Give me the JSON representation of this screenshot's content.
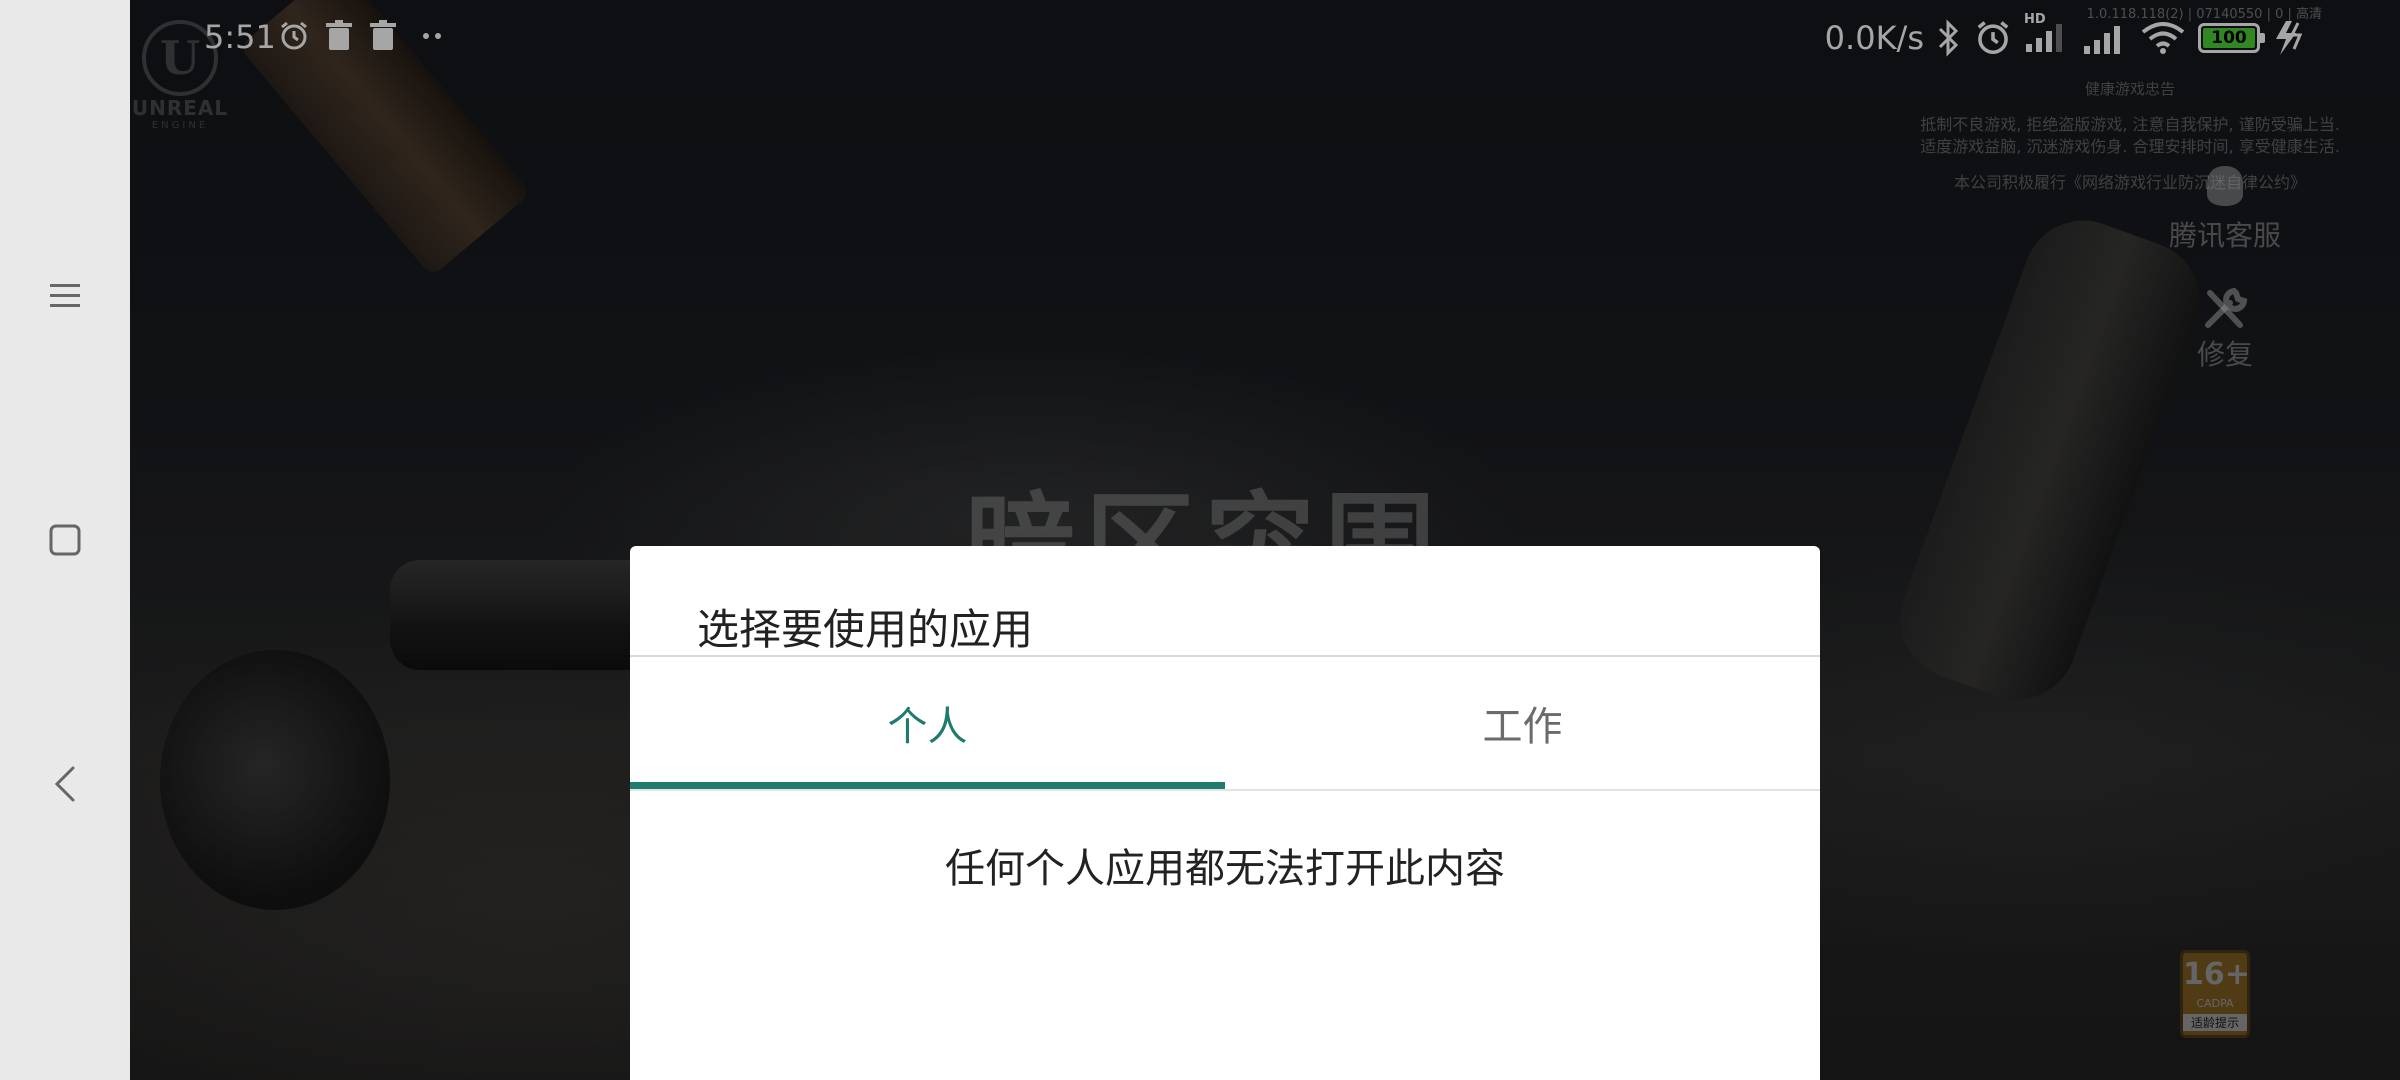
{
  "statusbar": {
    "time": "5:51",
    "net_speed": "0.0K/s",
    "hd_label": "HD",
    "battery": "100",
    "left_icons": [
      "alarm-icon",
      "trash-icon",
      "trash-icon",
      "more-dots-icon"
    ],
    "right_icons": [
      "bluetooth-icon",
      "alarm-icon",
      "signal-icon",
      "signal-icon",
      "wifi-icon",
      "battery-icon",
      "charging-icon"
    ]
  },
  "navbar": {
    "items": [
      "menu-icon",
      "home-square-icon",
      "back-icon"
    ]
  },
  "game": {
    "version": "1.0.118.118(2) | 07140550 | 0 | 高清",
    "engine_logo": "UNREAL",
    "engine_logo_sub": "ENGINE",
    "title": "暗区突围",
    "notice_heading": "健康游戏忠告",
    "notice_line1": "抵制不良游戏, 拒绝盗版游戏, 注意自我保护, 谨防受骗上当.",
    "notice_line2": "适度游戏益脑, 沉迷游戏伤身. 合理安排时间, 享受健康生活.",
    "notice_line3": "本公司积极履行《网络游戏行业防沉迷自律公约》",
    "customer_service": "腾讯客服",
    "repair": "修复",
    "age_rating": "16+",
    "age_rating_org": "CADPA",
    "age_rating_text": "适龄提示"
  },
  "dialog": {
    "title": "选择要使用的应用",
    "tabs": [
      {
        "label": "个人",
        "active": true
      },
      {
        "label": "工作",
        "active": false
      }
    ],
    "empty_message": "任何个人应用都无法打开此内容",
    "accent_color": "#1f7b6e"
  }
}
